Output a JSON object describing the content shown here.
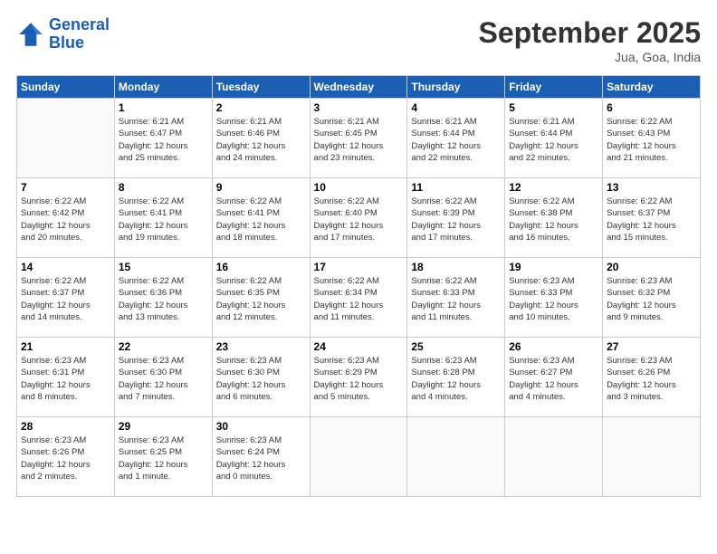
{
  "header": {
    "logo_line1": "General",
    "logo_line2": "Blue",
    "month": "September 2025",
    "location": "Jua, Goa, India"
  },
  "days_of_week": [
    "Sunday",
    "Monday",
    "Tuesday",
    "Wednesday",
    "Thursday",
    "Friday",
    "Saturday"
  ],
  "weeks": [
    [
      {
        "day": "",
        "info": ""
      },
      {
        "day": "1",
        "info": "Sunrise: 6:21 AM\nSunset: 6:47 PM\nDaylight: 12 hours\nand 25 minutes."
      },
      {
        "day": "2",
        "info": "Sunrise: 6:21 AM\nSunset: 6:46 PM\nDaylight: 12 hours\nand 24 minutes."
      },
      {
        "day": "3",
        "info": "Sunrise: 6:21 AM\nSunset: 6:45 PM\nDaylight: 12 hours\nand 23 minutes."
      },
      {
        "day": "4",
        "info": "Sunrise: 6:21 AM\nSunset: 6:44 PM\nDaylight: 12 hours\nand 22 minutes."
      },
      {
        "day": "5",
        "info": "Sunrise: 6:21 AM\nSunset: 6:44 PM\nDaylight: 12 hours\nand 22 minutes."
      },
      {
        "day": "6",
        "info": "Sunrise: 6:22 AM\nSunset: 6:43 PM\nDaylight: 12 hours\nand 21 minutes."
      }
    ],
    [
      {
        "day": "7",
        "info": "Sunrise: 6:22 AM\nSunset: 6:42 PM\nDaylight: 12 hours\nand 20 minutes."
      },
      {
        "day": "8",
        "info": "Sunrise: 6:22 AM\nSunset: 6:41 PM\nDaylight: 12 hours\nand 19 minutes."
      },
      {
        "day": "9",
        "info": "Sunrise: 6:22 AM\nSunset: 6:41 PM\nDaylight: 12 hours\nand 18 minutes."
      },
      {
        "day": "10",
        "info": "Sunrise: 6:22 AM\nSunset: 6:40 PM\nDaylight: 12 hours\nand 17 minutes."
      },
      {
        "day": "11",
        "info": "Sunrise: 6:22 AM\nSunset: 6:39 PM\nDaylight: 12 hours\nand 17 minutes."
      },
      {
        "day": "12",
        "info": "Sunrise: 6:22 AM\nSunset: 6:38 PM\nDaylight: 12 hours\nand 16 minutes."
      },
      {
        "day": "13",
        "info": "Sunrise: 6:22 AM\nSunset: 6:37 PM\nDaylight: 12 hours\nand 15 minutes."
      }
    ],
    [
      {
        "day": "14",
        "info": "Sunrise: 6:22 AM\nSunset: 6:37 PM\nDaylight: 12 hours\nand 14 minutes."
      },
      {
        "day": "15",
        "info": "Sunrise: 6:22 AM\nSunset: 6:36 PM\nDaylight: 12 hours\nand 13 minutes."
      },
      {
        "day": "16",
        "info": "Sunrise: 6:22 AM\nSunset: 6:35 PM\nDaylight: 12 hours\nand 12 minutes."
      },
      {
        "day": "17",
        "info": "Sunrise: 6:22 AM\nSunset: 6:34 PM\nDaylight: 12 hours\nand 11 minutes."
      },
      {
        "day": "18",
        "info": "Sunrise: 6:22 AM\nSunset: 6:33 PM\nDaylight: 12 hours\nand 11 minutes."
      },
      {
        "day": "19",
        "info": "Sunrise: 6:23 AM\nSunset: 6:33 PM\nDaylight: 12 hours\nand 10 minutes."
      },
      {
        "day": "20",
        "info": "Sunrise: 6:23 AM\nSunset: 6:32 PM\nDaylight: 12 hours\nand 9 minutes."
      }
    ],
    [
      {
        "day": "21",
        "info": "Sunrise: 6:23 AM\nSunset: 6:31 PM\nDaylight: 12 hours\nand 8 minutes."
      },
      {
        "day": "22",
        "info": "Sunrise: 6:23 AM\nSunset: 6:30 PM\nDaylight: 12 hours\nand 7 minutes."
      },
      {
        "day": "23",
        "info": "Sunrise: 6:23 AM\nSunset: 6:30 PM\nDaylight: 12 hours\nand 6 minutes."
      },
      {
        "day": "24",
        "info": "Sunrise: 6:23 AM\nSunset: 6:29 PM\nDaylight: 12 hours\nand 5 minutes."
      },
      {
        "day": "25",
        "info": "Sunrise: 6:23 AM\nSunset: 6:28 PM\nDaylight: 12 hours\nand 4 minutes."
      },
      {
        "day": "26",
        "info": "Sunrise: 6:23 AM\nSunset: 6:27 PM\nDaylight: 12 hours\nand 4 minutes."
      },
      {
        "day": "27",
        "info": "Sunrise: 6:23 AM\nSunset: 6:26 PM\nDaylight: 12 hours\nand 3 minutes."
      }
    ],
    [
      {
        "day": "28",
        "info": "Sunrise: 6:23 AM\nSunset: 6:26 PM\nDaylight: 12 hours\nand 2 minutes."
      },
      {
        "day": "29",
        "info": "Sunrise: 6:23 AM\nSunset: 6:25 PM\nDaylight: 12 hours\nand 1 minute."
      },
      {
        "day": "30",
        "info": "Sunrise: 6:23 AM\nSunset: 6:24 PM\nDaylight: 12 hours\nand 0 minutes."
      },
      {
        "day": "",
        "info": ""
      },
      {
        "day": "",
        "info": ""
      },
      {
        "day": "",
        "info": ""
      },
      {
        "day": "",
        "info": ""
      }
    ]
  ]
}
